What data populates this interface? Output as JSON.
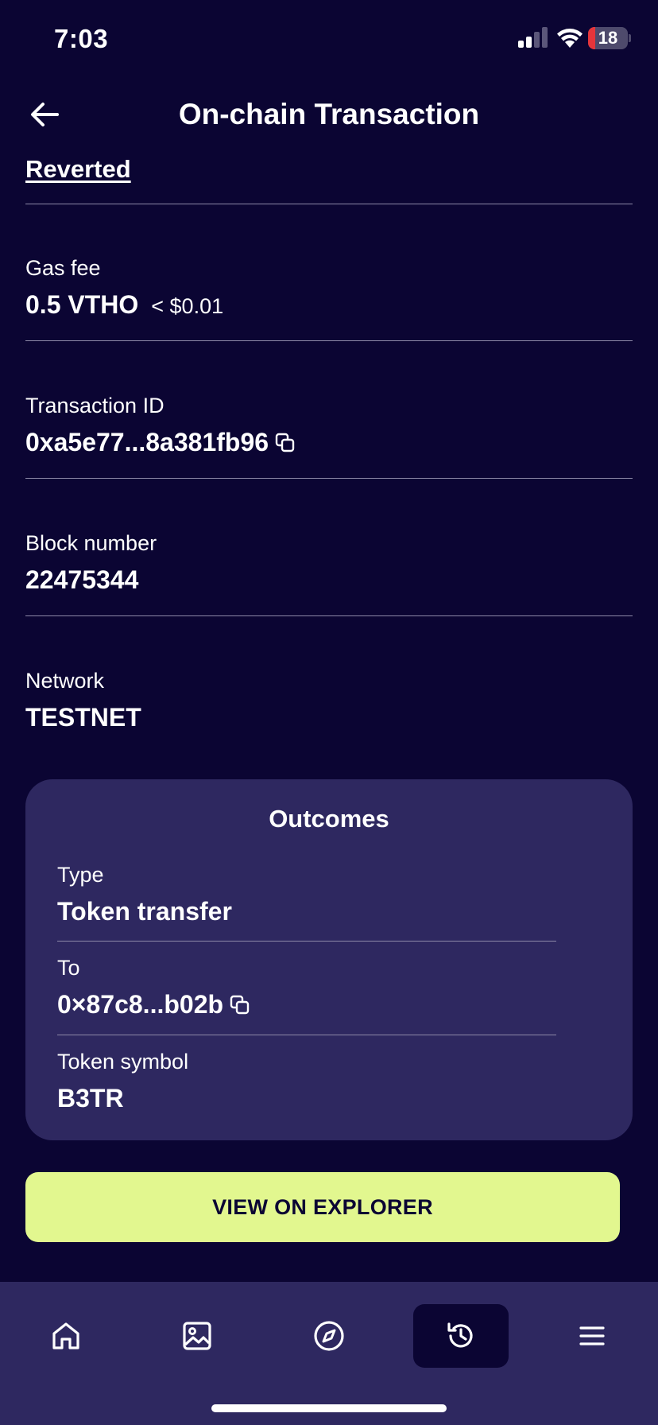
{
  "status_bar": {
    "time": "7:03",
    "battery_level": "18",
    "battery_color": "#e5353b"
  },
  "header": {
    "title": "On-chain Transaction",
    "back_icon": "arrow-left-icon"
  },
  "status_link": "Reverted",
  "fields": {
    "gas_fee": {
      "label": "Gas fee",
      "value": "0.5 VTHO",
      "usd": "< $0.01"
    },
    "transaction_id": {
      "label": "Transaction ID",
      "value": "0xa5e77...8a381fb96",
      "icon": "copy-icon"
    },
    "block_number": {
      "label": "Block number",
      "value": "22475344"
    },
    "network": {
      "label": "Network",
      "value": "TESTNET"
    }
  },
  "outcomes": {
    "title": "Outcomes",
    "type": {
      "label": "Type",
      "value": "Token transfer"
    },
    "to": {
      "label": "To",
      "value": "0×87c8...b02b",
      "icon": "copy-icon"
    },
    "token_symbol": {
      "label": "Token symbol",
      "value": "B3TR"
    }
  },
  "explorer_button": {
    "label": "VIEW ON EXPLORER"
  },
  "bottom_nav": {
    "items": [
      {
        "icon": "home-icon"
      },
      {
        "icon": "image-icon"
      },
      {
        "icon": "compass-icon"
      },
      {
        "icon": "history-icon",
        "active": true
      },
      {
        "icon": "menu-icon"
      }
    ]
  },
  "colors": {
    "background": "#0b0533",
    "card": "#2e2860",
    "accent": "#e2f78f"
  }
}
